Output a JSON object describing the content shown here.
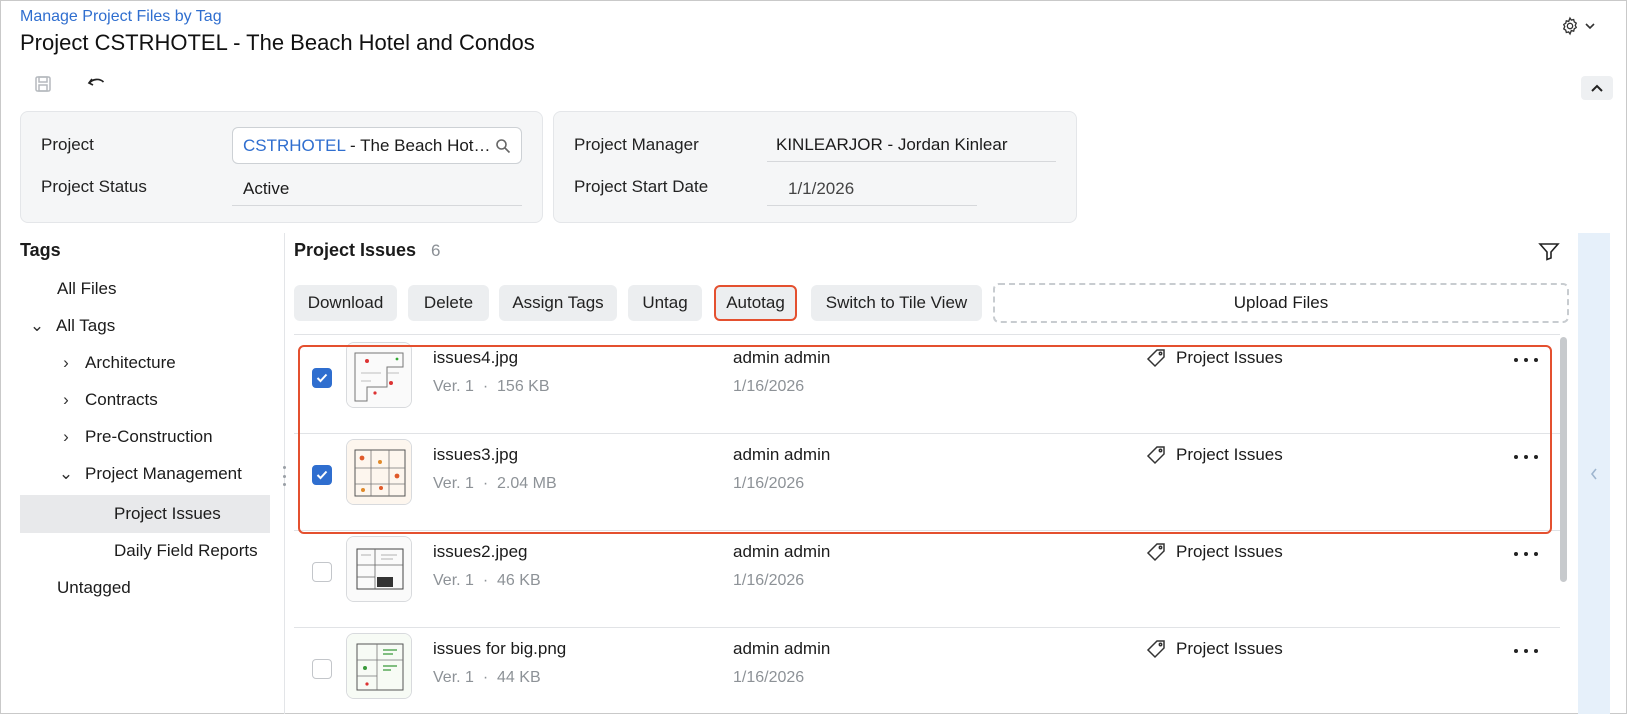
{
  "header": {
    "breadcrumb": "Manage Project Files by Tag",
    "title": "Project CSTRHOTEL - The Beach Hotel and Condos"
  },
  "summary": {
    "project_label": "Project",
    "project_code": "CSTRHOTEL",
    "project_name": " - The Beach Hotel and Condos",
    "status_label": "Project Status",
    "status_value": "Active",
    "manager_label": "Project Manager",
    "manager_value": "KINLEARJOR - Jordan Kinlear",
    "start_label": "Project Start Date",
    "start_value": "1/1/2026"
  },
  "tags_panel": {
    "heading": "Tags",
    "items": [
      {
        "label": "All Files"
      },
      {
        "label": "All Tags"
      },
      {
        "label": "Architecture"
      },
      {
        "label": "Contracts"
      },
      {
        "label": "Pre-Construction"
      },
      {
        "label": "Project Management"
      },
      {
        "label": "Project Issues"
      },
      {
        "label": "Daily Field Reports"
      },
      {
        "label": "Untagged"
      }
    ]
  },
  "grid": {
    "title": "Project Issues",
    "count": "6",
    "actions": {
      "download": "Download",
      "delete": "Delete",
      "assign_tags": "Assign Tags",
      "untag": "Untag",
      "autotag": "Autotag",
      "switch_view": "Switch to Tile View",
      "upload": "Upload Files"
    },
    "rows": [
      {
        "name": "issues4.jpg",
        "version": "Ver. 1",
        "size": "156 KB",
        "owner": "admin admin",
        "date": "1/16/2026",
        "tag": "Project Issues",
        "checked": true
      },
      {
        "name": "issues3.jpg",
        "version": "Ver. 1",
        "size": "2.04 MB",
        "owner": "admin admin",
        "date": "1/16/2026",
        "tag": "Project Issues",
        "checked": true
      },
      {
        "name": "issues2.jpeg",
        "version": "Ver. 1",
        "size": "46 KB",
        "owner": "admin admin",
        "date": "1/16/2026",
        "tag": "Project Issues",
        "checked": false
      },
      {
        "name": "issues for big.png",
        "version": "Ver. 1",
        "size": "44 KB",
        "owner": "admin admin",
        "date": "1/16/2026",
        "tag": "Project Issues",
        "checked": false
      }
    ],
    "meta_separator": "·"
  },
  "colors": {
    "accent": "#2f6ecf",
    "highlight": "#e4502f"
  }
}
